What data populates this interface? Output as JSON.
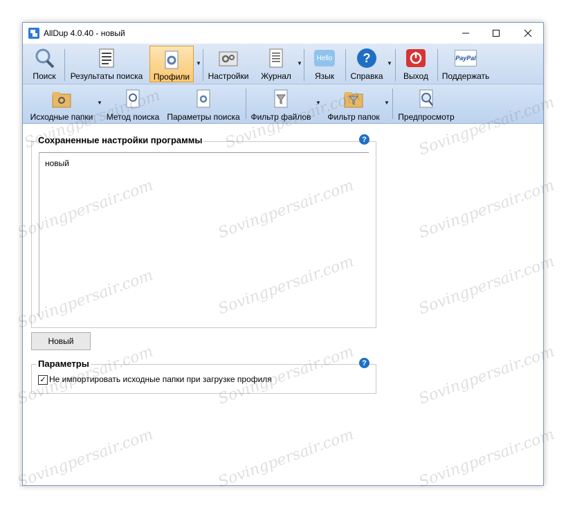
{
  "window": {
    "title": "AllDup 4.0.40 - новый"
  },
  "toolbar_main": {
    "search": "Поиск",
    "results": "Результаты поиска",
    "profiles": "Профили",
    "settings": "Настройки",
    "log": "Журнал",
    "language": "Язык",
    "help": "Справка",
    "exit": "Выход",
    "support": "Поддержать",
    "hello_icon_text": "Hello",
    "paypal_icon_text": "PayPal"
  },
  "toolbar_sub": {
    "source_folders": "Исходные папки",
    "search_method": "Метод поиска",
    "search_params": "Параметры поиска",
    "file_filter": "Фильтр файлов",
    "folder_filter": "Фильтр папок",
    "preview": "Предпросмотр"
  },
  "saved_settings": {
    "title": "Сохраненные настройки программы",
    "items": [
      "новый"
    ],
    "new_button": "Новый"
  },
  "parameters": {
    "title": "Параметры",
    "no_import_label": "Не импортировать исходные папки при загрузке профиля",
    "no_import_checked": true
  },
  "watermark": "Sovingpersair.com",
  "colors": {
    "accent": "#1f6fc5",
    "active_tab": "#f9c872",
    "toolbar": "#c7d9f0"
  }
}
